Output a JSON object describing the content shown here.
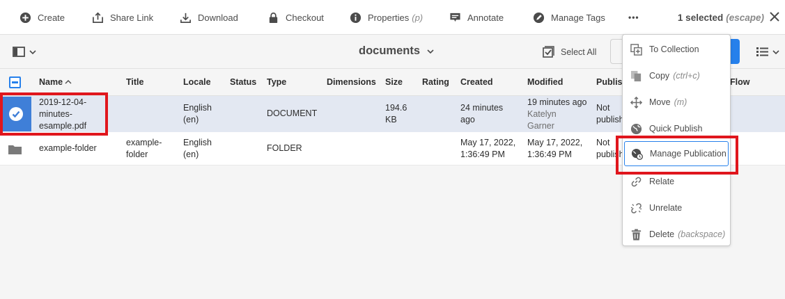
{
  "toolbar": {
    "create": "Create",
    "share_link": "Share Link",
    "download": "Download",
    "checkout": "Checkout",
    "properties": "Properties",
    "properties_hint": "(p)",
    "annotate": "Annotate",
    "manage_tags": "Manage Tags",
    "more": "•••",
    "selected": "1 selected",
    "selected_hint": "(escape)"
  },
  "subheader": {
    "title": "documents",
    "select_all": "Select All"
  },
  "columns": [
    "Name",
    "Title",
    "Locale",
    "Status",
    "Type",
    "Dimensions",
    "Size",
    "Rating",
    "Created",
    "Modified",
    "Publish",
    "Flow"
  ],
  "rows": [
    {
      "name": [
        "2019-12-04-",
        "minutes-",
        "esample.pdf"
      ],
      "title": [
        "",
        ""
      ],
      "locale": [
        "English",
        "(en)"
      ],
      "type": "DOCUMENT",
      "size": [
        "194.6",
        "KB"
      ],
      "created": [
        "24 minutes",
        "ago"
      ],
      "modified": [
        "19 minutes ago",
        "Katelyn",
        "Garner"
      ],
      "publish": [
        "Not",
        "publish"
      ]
    },
    {
      "name": [
        "example-folder"
      ],
      "title": [
        "example-",
        "folder"
      ],
      "locale": [
        "English",
        "(en)"
      ],
      "type": "FOLDER",
      "created": [
        "May 17, 2022,",
        "1:36:49 PM"
      ],
      "modified": [
        "May 17, 2022,",
        "1:36:49 PM"
      ],
      "publish": [
        "Not",
        "publish"
      ]
    }
  ],
  "menu": {
    "to_collection": "To Collection",
    "copy": "Copy",
    "copy_hint": "(ctrl+c)",
    "move": "Move",
    "move_hint": "(m)",
    "quick_publish": "Quick Publish",
    "manage_publication": "Manage Publication",
    "relate": "Relate",
    "unrelate": "Unrelate",
    "delete": "Delete",
    "delete_hint": "(backspace)"
  },
  "colors": {
    "accent": "#2680eb",
    "selected_row": "#e3e8f2",
    "highlight": "#e0161d"
  }
}
